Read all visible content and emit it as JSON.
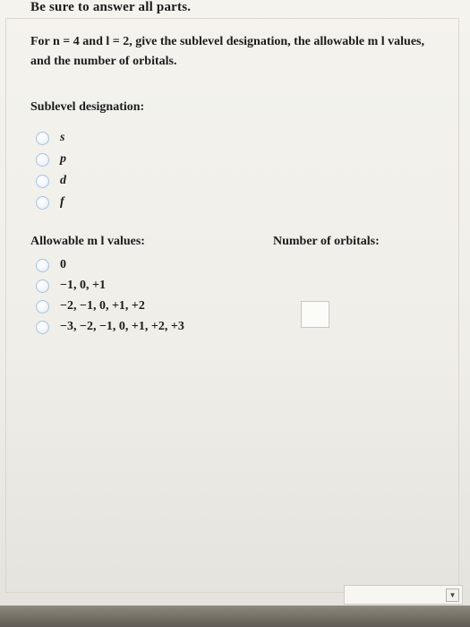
{
  "instruction": "Be sure to answer all parts.",
  "question": {
    "text": "For n = 4 and l = 2, give the sublevel designation, the allowable m l values, and the number of orbitals."
  },
  "sublevel": {
    "label": "Sublevel designation:",
    "options": [
      "s",
      "p",
      "d",
      "f"
    ]
  },
  "ml": {
    "label": "Allowable m l values:",
    "options": [
      "0",
      "−1, 0, +1",
      "−2, −1, 0, +1, +2",
      "−3, −2, −1, 0, +1, +2, +3"
    ]
  },
  "orbitals": {
    "label": "Number of orbitals:",
    "value": ""
  },
  "bottom_dropdown": {
    "value": ""
  },
  "icons": {
    "dropdown": "chevron-down-icon",
    "radio": "radio-button-icon"
  }
}
